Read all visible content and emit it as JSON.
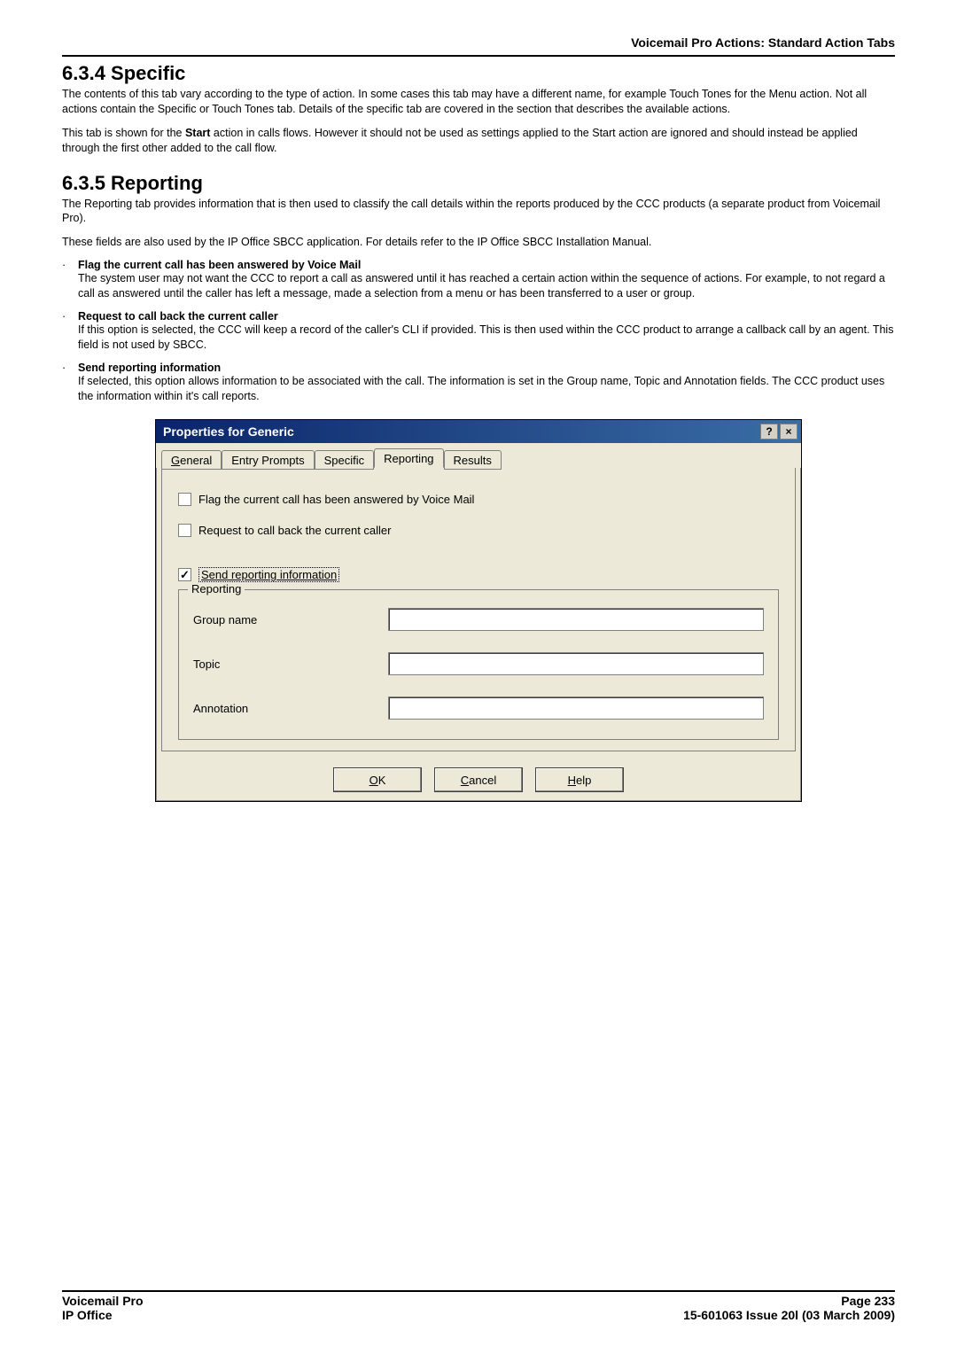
{
  "header": {
    "breadcrumb": "Voicemail Pro Actions: Standard Action Tabs"
  },
  "sections": {
    "specific": {
      "heading": "6.3.4 Specific",
      "p1": "The contents of this tab vary according to the type of action. In some cases this tab may have a different name, for example Touch Tones for the Menu action.  Not all actions contain the Specific or Touch Tones tab. Details of the specific tab are covered in the section that describes the available actions.",
      "p2_pre": "This tab is shown for the ",
      "p2_bold": "Start",
      "p2_post": " action in calls flows. However it should not be used as settings applied to the Start action are ignored and should instead be applied through the first other added to the call flow."
    },
    "reporting": {
      "heading": "6.3.5 Reporting",
      "p1": "The Reporting tab provides information that is then used to classify the call details within the reports produced by the CCC products (a separate product from Voicemail Pro).",
      "p2": "These fields are also used by the IP Office SBCC application. For details refer to the IP Office SBCC Installation Manual.",
      "bullets": [
        {
          "title": "Flag the current call has been answered by Voice Mail",
          "text": "The system user may not want the CCC to report a call as answered until it has reached a certain action within the sequence of actions. For example, to not regard a call as answered until the caller has left a message, made a selection from a menu or has been transferred to a user or group."
        },
        {
          "title": "Request to call back the current caller",
          "text": "If this option is selected, the CCC will keep a record of the caller's CLI if provided. This is then used within the CCC product to arrange a callback call by an agent. This field is not used by SBCC."
        },
        {
          "title": "Send reporting information",
          "text": "If selected, this option allows information to be associated with the call. The information is set in the Group name, Topic and Annotation fields. The CCC product uses the information within it's call reports."
        }
      ]
    }
  },
  "dialog": {
    "title": "Properties for Generic",
    "help_btn": "?",
    "close_btn": "×",
    "tabs": {
      "general": "eneral",
      "general_u": "G",
      "entry_prompts": "Entry Prompts",
      "specific": "Specific",
      "reporting": "Reporting",
      "results": "Results"
    },
    "checks": {
      "flag": "Flag the current call has been answered by Voice Mail",
      "request": "Request to call back the current caller",
      "send": "Send reporting information"
    },
    "group": {
      "legend": "Reporting",
      "group_name": "Group name",
      "topic": "Topic",
      "annotation": "Annotation"
    },
    "buttons": {
      "ok_u": "O",
      "ok": "K",
      "cancel_u": "C",
      "cancel": "ancel",
      "help_u": "H",
      "help": "elp"
    }
  },
  "footer": {
    "left1": "Voicemail Pro",
    "left2": "IP Office",
    "right1": "Page 233",
    "right2": "15-601063 Issue 20l (03 March 2009)"
  }
}
